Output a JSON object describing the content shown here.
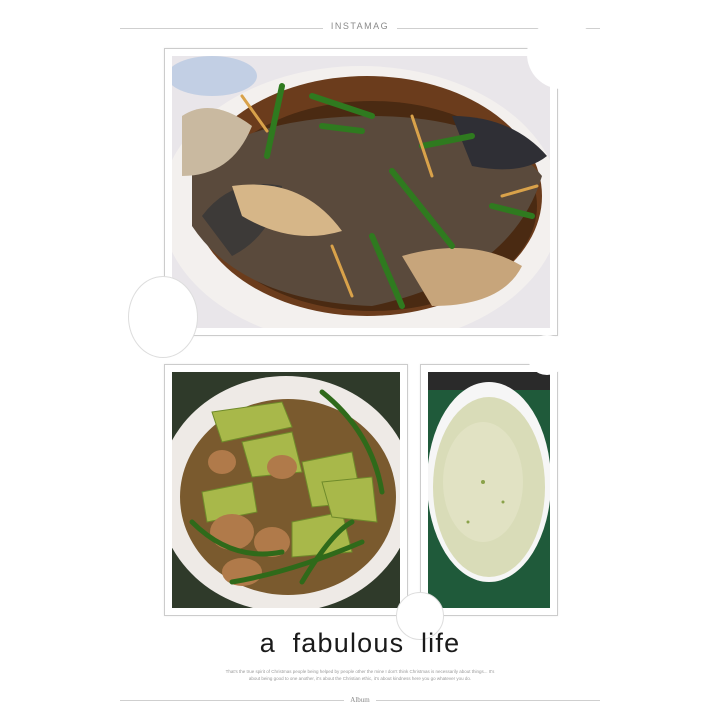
{
  "header": {
    "title": "INSTAMAG"
  },
  "photos": [
    {
      "description_icon": "braised-fish-photo"
    },
    {
      "description_icon": "stir-fried-vegetables-photo"
    },
    {
      "description_icon": "soup-bowl-photo"
    }
  ],
  "caption": {
    "tagline": "a  fabulous  life",
    "small_text": "That's the true spirit of Christmas people being helped by people other the mine I don't think Christmas is necessarily about things... It's about being good to one another, it's about the Christian ethic, it's about kindness here you go whatever you do."
  },
  "footer": {
    "title": "Album"
  },
  "colors": {
    "background": "#ffffff",
    "rule": "#cfcfcf",
    "tagline": "#1a1a1a"
  }
}
